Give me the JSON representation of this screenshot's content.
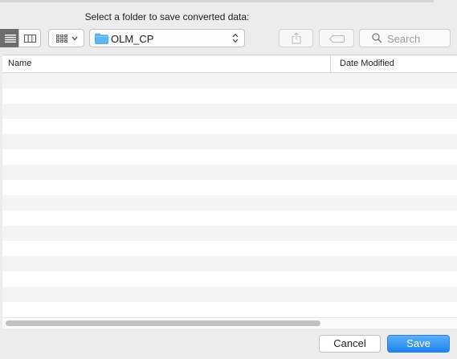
{
  "dialog": {
    "prompt": "Select a folder to save converted data:"
  },
  "toolbar": {
    "view_list_icon": "list-view-icon",
    "view_columns_icon": "column-view-icon",
    "arrange_icon": "grid-arrange-icon",
    "path_popup": {
      "folder_icon": "folder-icon",
      "label": "OLM_CP",
      "chevron_icon": "up-down-chevron-icon"
    },
    "share_icon": "share-icon",
    "tag_icon": "tag-icon",
    "search": {
      "placeholder": "Search",
      "icon": "search-icon"
    }
  },
  "file_list": {
    "columns": [
      "Name",
      "Date Modified"
    ],
    "rows": [
      {
        "name": "",
        "date_modified": ""
      },
      {
        "name": "",
        "date_modified": ""
      },
      {
        "name": "",
        "date_modified": ""
      },
      {
        "name": "",
        "date_modified": ""
      },
      {
        "name": "",
        "date_modified": ""
      },
      {
        "name": "",
        "date_modified": ""
      },
      {
        "name": "",
        "date_modified": ""
      },
      {
        "name": "",
        "date_modified": ""
      },
      {
        "name": "",
        "date_modified": ""
      },
      {
        "name": "",
        "date_modified": ""
      },
      {
        "name": "",
        "date_modified": ""
      },
      {
        "name": "",
        "date_modified": ""
      },
      {
        "name": "",
        "date_modified": ""
      },
      {
        "name": "",
        "date_modified": ""
      },
      {
        "name": "",
        "date_modified": ""
      },
      {
        "name": "",
        "date_modified": ""
      }
    ]
  },
  "footer": {
    "cancel_label": "Cancel",
    "save_label": "Save"
  },
  "colors": {
    "accent": "#1c84f0",
    "folder": "#5cb7f2",
    "window_bg": "#ececec",
    "stripe": "#f4f4f4"
  }
}
